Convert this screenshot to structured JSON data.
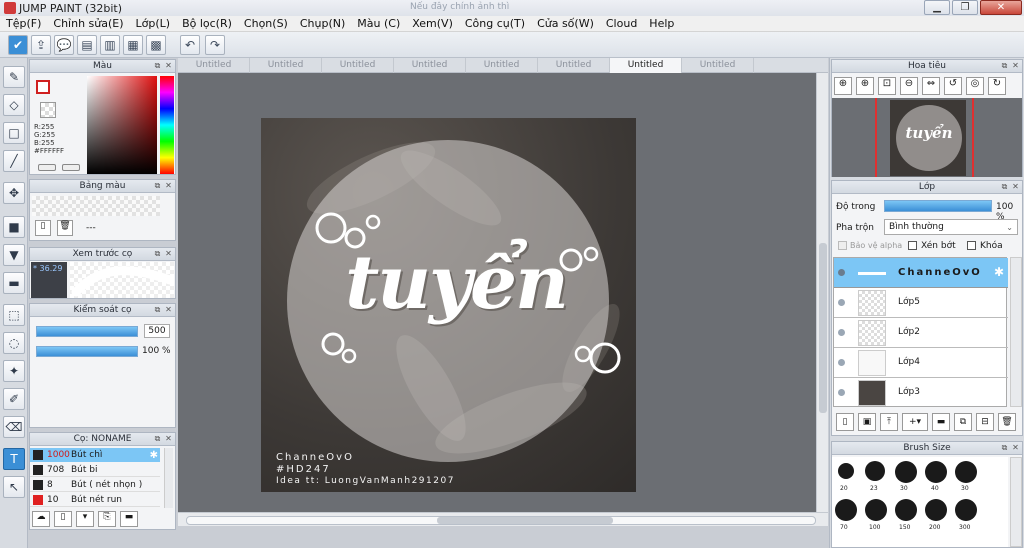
{
  "window": {
    "title": "JUMP PAINT (32bit)",
    "faint_title": "Nếu đây chính ảnh thì",
    "buttons": {
      "minimize": "▁",
      "restore": "❐",
      "close": "✕"
    }
  },
  "menu": [
    "Tệp(F)",
    "Chỉnh sửa(E)",
    "Lớp(L)",
    "Bộ lọc(R)",
    "Chọn(S)",
    "Chụp(N)",
    "Màu (C)",
    "Xem(V)",
    "Công cụ(T)",
    "Cửa số(W)",
    "Cloud",
    "Help"
  ],
  "toolbar_icons": [
    "check-icon",
    "share-icon",
    "comment-icon",
    "message-icon",
    "page-icon",
    "document-icon",
    "layout-icon",
    "undo-icon",
    "redo-icon"
  ],
  "tabs": [
    {
      "label": "Untitled",
      "active": false
    },
    {
      "label": "Untitled",
      "active": false
    },
    {
      "label": "Untitled",
      "active": false
    },
    {
      "label": "Untitled",
      "active": false
    },
    {
      "label": "Untitled",
      "active": false
    },
    {
      "label": "Untitled",
      "active": false
    },
    {
      "label": "Untitled",
      "active": true
    },
    {
      "label": "Untitled",
      "active": false
    }
  ],
  "color_panel": {
    "title": "Màu",
    "r": "R:255",
    "g": "G:255",
    "b": "B:255",
    "hex": "#FFFFFF"
  },
  "swatch_panel": {
    "title": "Bảng màu",
    "dash": "---"
  },
  "brush_preview_panel": {
    "title": "Xem trước cọ",
    "size": "* 36.29"
  },
  "brush_control_panel": {
    "title": "Kiểm soát cọ",
    "size_value": "500",
    "opacity_value": "100 %"
  },
  "brush_list_panel": {
    "title": "Cọ: NONAME",
    "items": [
      {
        "size": "1000",
        "name": "Bút chì",
        "selected": true
      },
      {
        "size": "708",
        "name": "Bút bi",
        "selected": false
      },
      {
        "size": "8",
        "name": "Bút ( nét nhọn )",
        "selected": false
      },
      {
        "size": "10",
        "name": "Bút nét run",
        "selected": false
      }
    ]
  },
  "artwork": {
    "word": "tuyển",
    "credit1": "ChanneOvO",
    "credit2": "#HD247",
    "credit3": "Idea tt: LuongVanManh291207"
  },
  "navigator_panel": {
    "title": "Hoa tiêu",
    "thumb_word": "tuyển"
  },
  "layer_panel": {
    "title": "Lớp",
    "opacity_label": "Độ trong",
    "opacity_value": "100 %",
    "opacity_fraction": 1.0,
    "blend_label": "Pha trộn",
    "blend_value": "Bình thường",
    "protect_alpha": "Bảo vệ alpha",
    "clipping": "Xén bớt",
    "lock": "Khóa",
    "layers": [
      {
        "name": "ChanneOvO",
        "selected": true
      },
      {
        "name": "Lớp5",
        "selected": false
      },
      {
        "name": "Lớp2",
        "selected": false
      },
      {
        "name": "Lớp4",
        "selected": false
      },
      {
        "name": "Lớp3",
        "selected": false
      }
    ]
  },
  "brush_size_panel": {
    "title": "Brush Size",
    "sizes": [
      "20",
      "23",
      "30",
      "40",
      "30",
      "70",
      "100",
      "150",
      "200",
      "300"
    ]
  },
  "colors": {
    "accent": "#3b8fd6",
    "selection": "#7cc6f5",
    "canvas_bg": "#6b6e73"
  }
}
